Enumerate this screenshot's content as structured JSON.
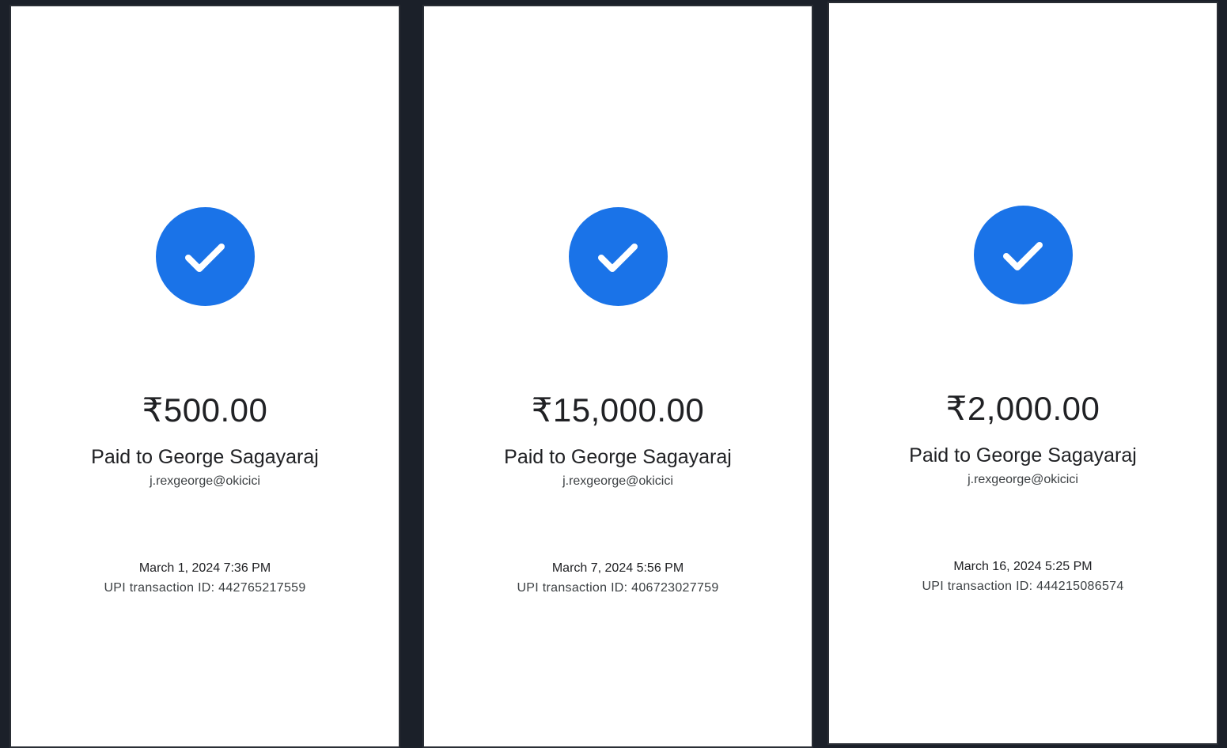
{
  "receipts": [
    {
      "amount": "₹500.00",
      "paid_to": "Paid to George Sagayaraj",
      "upi_id": "j.rexgeorge@okicici",
      "datetime": "March 1, 2024 7:36 PM",
      "transaction": "UPI transaction ID: 442765217559"
    },
    {
      "amount": "₹15,000.00",
      "paid_to": "Paid to George Sagayaraj",
      "upi_id": "j.rexgeorge@okicici",
      "datetime": "March 7, 2024 5:56 PM",
      "transaction": "UPI transaction ID: 406723027759"
    },
    {
      "amount": "₹2,000.00",
      "paid_to": "Paid to George Sagayaraj",
      "upi_id": "j.rexgeorge@okicici",
      "datetime": "March 16, 2024 5:25 PM",
      "transaction": "UPI transaction ID: 444215086574"
    }
  ],
  "icon": "check-circle-icon",
  "colors": {
    "accent": "#1a73e8",
    "background": "#1b2029",
    "panel": "#ffffff",
    "text_primary": "#202124",
    "text_secondary": "#3c4043"
  }
}
